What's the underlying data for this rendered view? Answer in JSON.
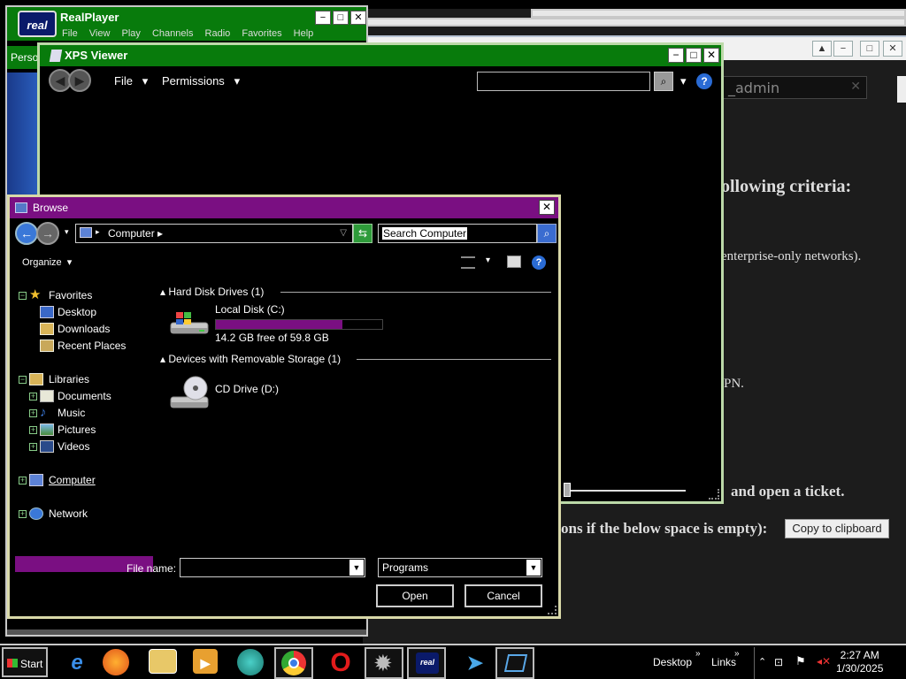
{
  "realplayer": {
    "title": "RealPlayer",
    "logo_text": "real",
    "menu": [
      "File",
      "View",
      "Play",
      "Channels",
      "Radio",
      "Favorites",
      "Help"
    ],
    "side_tab": "Perso"
  },
  "background_page": {
    "address_value": "_admin",
    "text_criteria": "ollowing criteria:",
    "text_enterprise": "enterprise-only networks).",
    "text_vpn": "PN.",
    "text_ticket": "and open a ticket.",
    "text_empty": "ons if the below space is empty):",
    "copy_button": "Copy to clipboard"
  },
  "xps": {
    "title": "XPS Viewer",
    "menu_file": "File",
    "menu_permissions": "Permissions"
  },
  "browse": {
    "title": "Browse",
    "breadcrumb": "Computer",
    "search_placeholder": "Search Computer",
    "organize": "Organize",
    "tree": {
      "favorites": "Favorites",
      "desktop": "Desktop",
      "downloads": "Downloads",
      "recent_places": "Recent Places",
      "libraries": "Libraries",
      "documents": "Documents",
      "music": "Music",
      "pictures": "Pictures",
      "videos": "Videos",
      "computer": "Computer",
      "network": "Network"
    },
    "group_hdd": "Hard Disk Drives (1)",
    "group_removable": "Devices with Removable Storage (1)",
    "drive_c": {
      "name": "Local Disk (C:)",
      "free_text": "14.2 GB free of 59.8 GB",
      "used_fraction": 0.76
    },
    "drive_d": {
      "name": "CD Drive (D:)"
    },
    "file_name_label": "File name:",
    "file_name_value": "",
    "filter": "Programs",
    "open_button": "Open",
    "cancel_button": "Cancel"
  },
  "taskbar": {
    "start": "Start",
    "desktop_label": "Desktop",
    "links_label": "Links",
    "time": "2:27 AM",
    "date": "1/30/2025"
  }
}
